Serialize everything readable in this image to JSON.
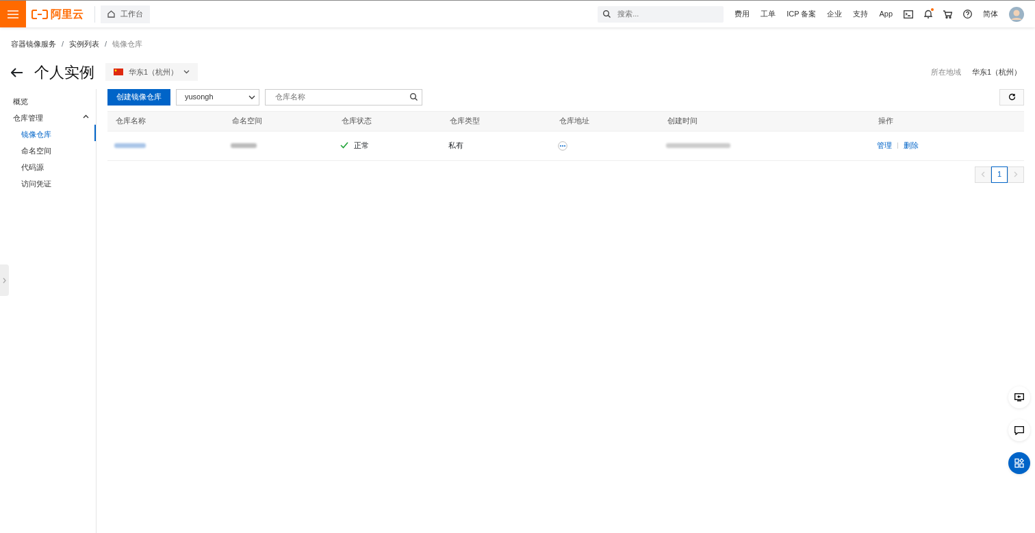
{
  "topbar": {
    "logo": "阿里云",
    "workbench": "工作台",
    "search": {
      "placeholder": "搜索..."
    },
    "links": [
      "费用",
      "工单",
      "ICP 备案",
      "企业",
      "支持",
      "App"
    ],
    "notification_dot": true,
    "language": "简体"
  },
  "breadcrumb": [
    "容器镜像服务",
    "实例列表",
    "镜像仓库"
  ],
  "breadcrumb_separator": "/",
  "header": {
    "title": "个人实例",
    "region": "华东1（杭州）",
    "region_label": "所在地域",
    "region_value": "华东1（杭州）"
  },
  "sidebar": {
    "items": [
      {
        "label": "概览",
        "selected": false
      },
      {
        "label": "仓库管理",
        "selected": false,
        "expanded": true,
        "children": [
          {
            "label": "镜像仓库",
            "selected": true
          },
          {
            "label": "命名空间",
            "selected": false
          },
          {
            "label": "代码源",
            "selected": false
          },
          {
            "label": "访问凭证",
            "selected": false
          }
        ]
      }
    ]
  },
  "toolbar": {
    "create_button": "创建镜像仓库",
    "namespace": "yusongh",
    "search": {
      "placeholder": "仓库名称"
    }
  },
  "table": {
    "columns": [
      "仓库名称",
      "命名空间",
      "仓库状态",
      "仓库类型",
      "仓库地址",
      "创建时间",
      "操作"
    ],
    "rows": [
      {
        "status": "正常",
        "type": "私有",
        "actions": [
          "管理",
          "删除"
        ]
      }
    ]
  },
  "pagination": {
    "pages": [
      {
        "label": "1",
        "selected": true
      }
    ]
  }
}
